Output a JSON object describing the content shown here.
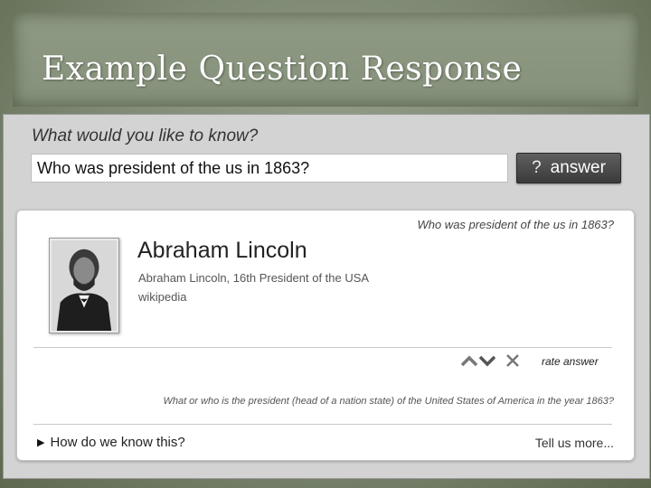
{
  "slide": {
    "title": "Example Question Response"
  },
  "app": {
    "prompt_label": "What would you like to know?",
    "query_value": "Who was president of the us in 1863?",
    "answer_button": {
      "icon_glyph": "?",
      "label": "answer"
    }
  },
  "result": {
    "echo_query": "Who was president of the us in 1863?",
    "title": "Abraham Lincoln",
    "description": "Abraham Lincoln, 16th President of the USA",
    "source": "wikipedia",
    "rate_label": "rate answer",
    "interpretation": "What or who is the president (head of a nation state) of the United States of America in the year 1863?",
    "how_link": "How do we know this?",
    "tell_more": "Tell us more..."
  }
}
